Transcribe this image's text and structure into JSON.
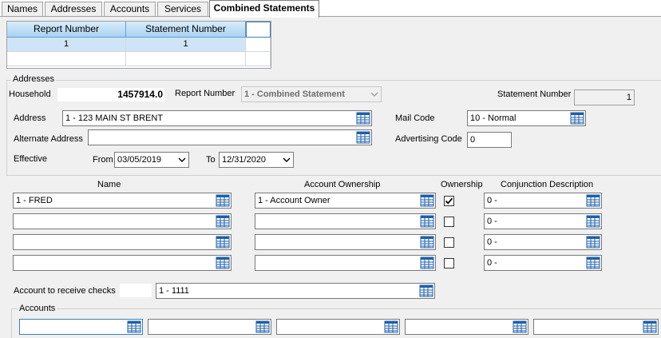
{
  "tabs": [
    {
      "label": "Names"
    },
    {
      "label": "Addresses"
    },
    {
      "label": "Accounts"
    },
    {
      "label": "Services"
    },
    {
      "label": "Combined Statements"
    }
  ],
  "grid": {
    "headers": [
      "Report Number",
      "Statement Number"
    ],
    "rows": [
      [
        "1",
        "1"
      ]
    ]
  },
  "addresses": {
    "group_title": "Addresses",
    "household_label": "Household",
    "household_value": "1457914.0",
    "report_number_label": "Report Number",
    "report_number_value": "1 - Combined Statement",
    "statement_number_label": "Statement Number",
    "statement_number_value": "1",
    "address_label": "Address",
    "address_value": "1 - 123 MAIN ST BRENT",
    "alt_address_label": "Alternate Address",
    "alt_address_value": "",
    "mail_code_label": "Mail Code",
    "mail_code_value": "10 - Normal",
    "advertising_code_label": "Advertising Code",
    "advertising_code_value": "0",
    "effective_label": "Effective",
    "from_label": "From",
    "from_value": "03/05/2019",
    "to_label": "To",
    "to_value": "12/31/2020"
  },
  "ownership": {
    "name_header": "Name",
    "account_ownership_header": "Account Ownership",
    "ownership_header": "Ownership",
    "conjunction_header": "Conjunction Description",
    "rows": [
      {
        "name": "1 - FRED",
        "account_ownership": "1 - Account Owner",
        "conjunction": "0 -"
      },
      {
        "name": "",
        "account_ownership": "",
        "conjunction": "0 -"
      },
      {
        "name": "",
        "account_ownership": "",
        "conjunction": "0 -"
      },
      {
        "name": "",
        "account_ownership": "",
        "conjunction": "0 -"
      }
    ],
    "ownership_checked": [
      true,
      false,
      false,
      false
    ]
  },
  "checks": {
    "label": "Account to receive checks",
    "value": "1 - 1111"
  },
  "accounts": {
    "group_title": "Accounts",
    "values": [
      "",
      "",
      "",
      "",
      ""
    ]
  },
  "colors": {
    "grid_header": "#a9d2f3",
    "selected_row": "#cfe4f7",
    "picker_icon": "#1f5fa8"
  },
  "icons": {
    "picker": "list-picker-icon",
    "dropdown": "chevron-down-icon",
    "check": "checkmark-icon"
  }
}
